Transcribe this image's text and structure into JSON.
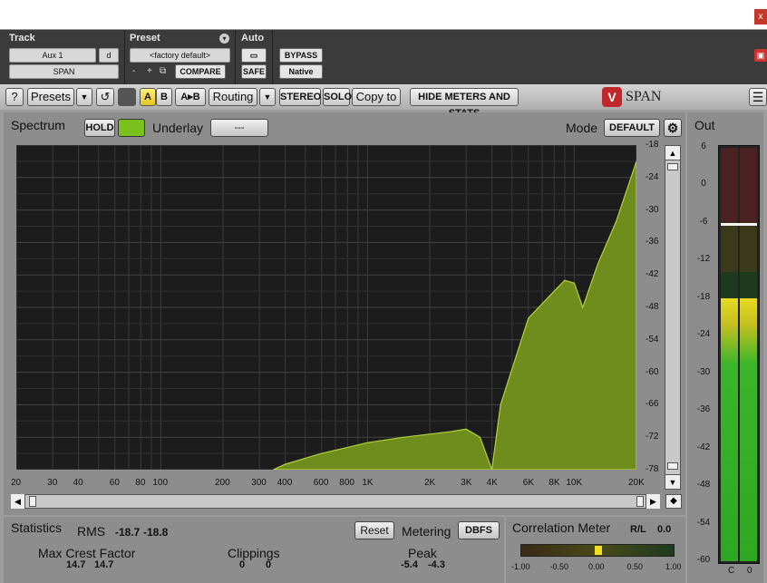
{
  "window": {
    "close_label": "x"
  },
  "header": {
    "track_label": "Track",
    "track_name": "Aux 1",
    "track_mode": "d",
    "insert_name": "SPAN",
    "preset_label": "Preset",
    "preset_name": "<factory default>",
    "preset_minus": "-",
    "preset_plus": "+",
    "compare_label": "COMPARE",
    "auto_label": "Auto",
    "safe_label": "SAFE",
    "bypass_label": "BYPASS",
    "native_label": "Native"
  },
  "toolbar": {
    "help_label": "?",
    "presets_label": "Presets",
    "undo_symbol": "↺",
    "a_label": "A",
    "b_label": "B",
    "ab_label": "A▸B",
    "routing_label": "Routing",
    "stereo_label": "STEREO",
    "solo_label": "SOLO",
    "copyto_label": "Copy to",
    "hide_label": "HIDE METERS AND STATS",
    "brand_name": "SPAN"
  },
  "spectrum": {
    "title": "Spectrum",
    "hold_label": "HOLD",
    "underlay_label": "Underlay",
    "underlay_value": "---",
    "mode_label": "Mode",
    "mode_value": "DEFAULT",
    "db_ticks": [
      "-18",
      "-24",
      "-30",
      "-36",
      "-42",
      "-48",
      "-54",
      "-60",
      "-66",
      "-72",
      "-78"
    ],
    "freq_ticks": [
      "20",
      "30",
      "40",
      "60",
      "80",
      "100",
      "200",
      "300",
      "400",
      "600",
      "800",
      "1K",
      "2K",
      "3K",
      "4K",
      "6K",
      "8K",
      "10K",
      "20K"
    ]
  },
  "out": {
    "title": "Out",
    "ticks": [
      "6",
      "0",
      "-6",
      "-12",
      "-18",
      "-24",
      "-30",
      "-36",
      "-42",
      "-48",
      "-54",
      "-60"
    ],
    "left_label": "C",
    "right_label": "0",
    "level_db": -18,
    "peak_db": -6
  },
  "statistics": {
    "title": "Statistics",
    "rms_label": "RMS",
    "rms_left": "-18.7",
    "rms_right": "-18.8",
    "reset_label": "Reset",
    "metering_label": "Metering",
    "metering_value": "DBFS",
    "crest_label": "Max Crest Factor",
    "crest_left": "14.7",
    "crest_right": "14.7",
    "clip_label": "Clippings",
    "clip_left": "0",
    "clip_right": "0",
    "peak_label": "Peak",
    "peak_left": "-5.4",
    "peak_right": "-4.3"
  },
  "correlation": {
    "title": "Correlation Meter",
    "rl_label": "R/L",
    "rl_value": "0.0",
    "ticks": [
      "-1.00",
      "-0.50",
      "0.00",
      "0.50",
      "1.00"
    ],
    "value": 0.0
  },
  "chart_data": {
    "type": "area",
    "x": [
      350,
      400,
      600,
      1000,
      1500,
      2500,
      3000,
      3500,
      4000,
      4400,
      6000,
      8000,
      9000,
      10000,
      11000,
      13000,
      16000,
      20000
    ],
    "y": [
      -78,
      -77,
      -75,
      -73,
      -72,
      -71,
      -70.5,
      -72,
      -78,
      -66,
      -50,
      -45,
      -43,
      -43.5,
      -48,
      -40,
      -32,
      -21
    ],
    "xlabel": "",
    "ylabel": "",
    "xscale": "log",
    "xlim": [
      20,
      20000
    ],
    "ylim": [
      -78,
      -18
    ],
    "colors": {
      "fill": "#6e8d1c",
      "line": "#b4d23c"
    }
  }
}
